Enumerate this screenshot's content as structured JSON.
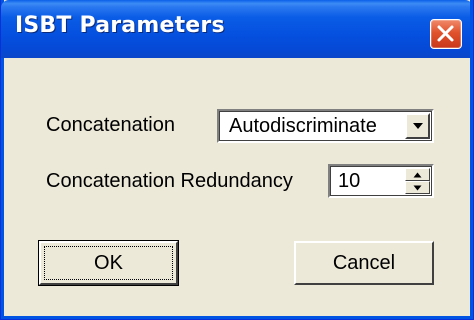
{
  "window": {
    "title": "ISBT Parameters",
    "close_icon": "close-icon"
  },
  "form": {
    "concatenation_label": "Concatenation",
    "concatenation_value": "Autodiscriminate",
    "redundancy_label": "Concatenation Redundancy",
    "redundancy_value": "10"
  },
  "buttons": {
    "ok_label": "OK",
    "cancel_label": "Cancel"
  },
  "colors": {
    "titlebar": "#0550df",
    "dialog_bg": "#ece9d8",
    "close_button": "#e0522c"
  }
}
